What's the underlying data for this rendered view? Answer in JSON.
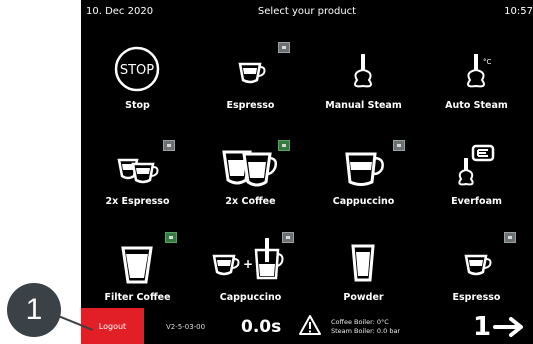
{
  "header": {
    "date": "10. Dec 2020",
    "title": "Select your product",
    "time": "10:57"
  },
  "tiles": [
    {
      "label": "Stop",
      "icon": "stop-icon",
      "stop_text": "STOP"
    },
    {
      "label": "Espresso",
      "icon": "espresso-cup-icon",
      "badge": "gray"
    },
    {
      "label": "Manual Steam",
      "icon": "manual-steam-icon"
    },
    {
      "label": "Auto Steam",
      "icon": "auto-steam-icon",
      "unit": "°C"
    },
    {
      "label": "2x Espresso",
      "icon": "double-espresso-icon",
      "badge": "gray"
    },
    {
      "label": "2x Coffee",
      "icon": "double-coffee-icon",
      "badge": "green"
    },
    {
      "label": "Cappuccino",
      "icon": "cappuccino-glass-icon",
      "badge": "gray"
    },
    {
      "label": "Everfoam",
      "icon": "everfoam-icon"
    },
    {
      "label": "Filter Coffee",
      "icon": "filter-coffee-icon",
      "badge": "green"
    },
    {
      "label": "Cappuccino",
      "icon": "cappuccino-combo-icon",
      "badge": "gray",
      "plus": "+"
    },
    {
      "label": "Powder",
      "icon": "powder-glass-icon"
    },
    {
      "label": "Espresso",
      "icon": "espresso-cup-icon",
      "badge": "gray"
    }
  ],
  "footer": {
    "logout_label": "Logout",
    "version": "V2-5-03-00",
    "timer": "0.0s",
    "coffee_boiler": "Coffee Boiler: 0°C",
    "steam_boiler": "Steam Boiler: 0.0 bar",
    "page_number": "1"
  },
  "callout": {
    "number": "1"
  },
  "colors": {
    "screen_bg": "#000000",
    "logout": "#e21e26",
    "badge_gray": "#6b7073",
    "badge_green": "#357a3f",
    "callout": "#3a4248"
  }
}
